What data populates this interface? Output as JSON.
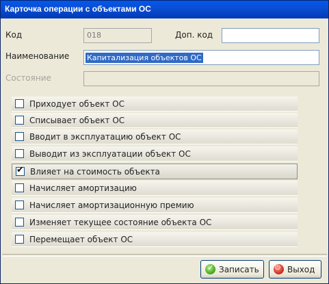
{
  "window": {
    "title": "Карточка операции с объектами ОС"
  },
  "form": {
    "code_label": "Код",
    "code_value": "018",
    "extra_code_label": "Доп. код",
    "extra_code_value": "",
    "name_label": "Наименование",
    "name_value": "Капитализация объектов ОС",
    "state_label": "Состояние",
    "state_value": ""
  },
  "checkboxes": [
    {
      "label": "Приходует объект ОС",
      "checked": false
    },
    {
      "label": "Списывает объект ОС",
      "checked": false
    },
    {
      "label": "Вводит в эксплуатацию объект ОС",
      "checked": false
    },
    {
      "label": "Выводит из эксплуатации объект ОС",
      "checked": false
    },
    {
      "label": "Влияет на стоимость объекта",
      "checked": true
    },
    {
      "label": "Начисляет амортизацию",
      "checked": false
    },
    {
      "label": "Начисляет амортизационную премию",
      "checked": false
    },
    {
      "label": "Изменяет текущее состояние объекта ОС",
      "checked": false
    },
    {
      "label": "Перемещает объект ОС",
      "checked": false
    }
  ],
  "buttons": {
    "save_label": "Записать",
    "exit_label": "Выход"
  }
}
